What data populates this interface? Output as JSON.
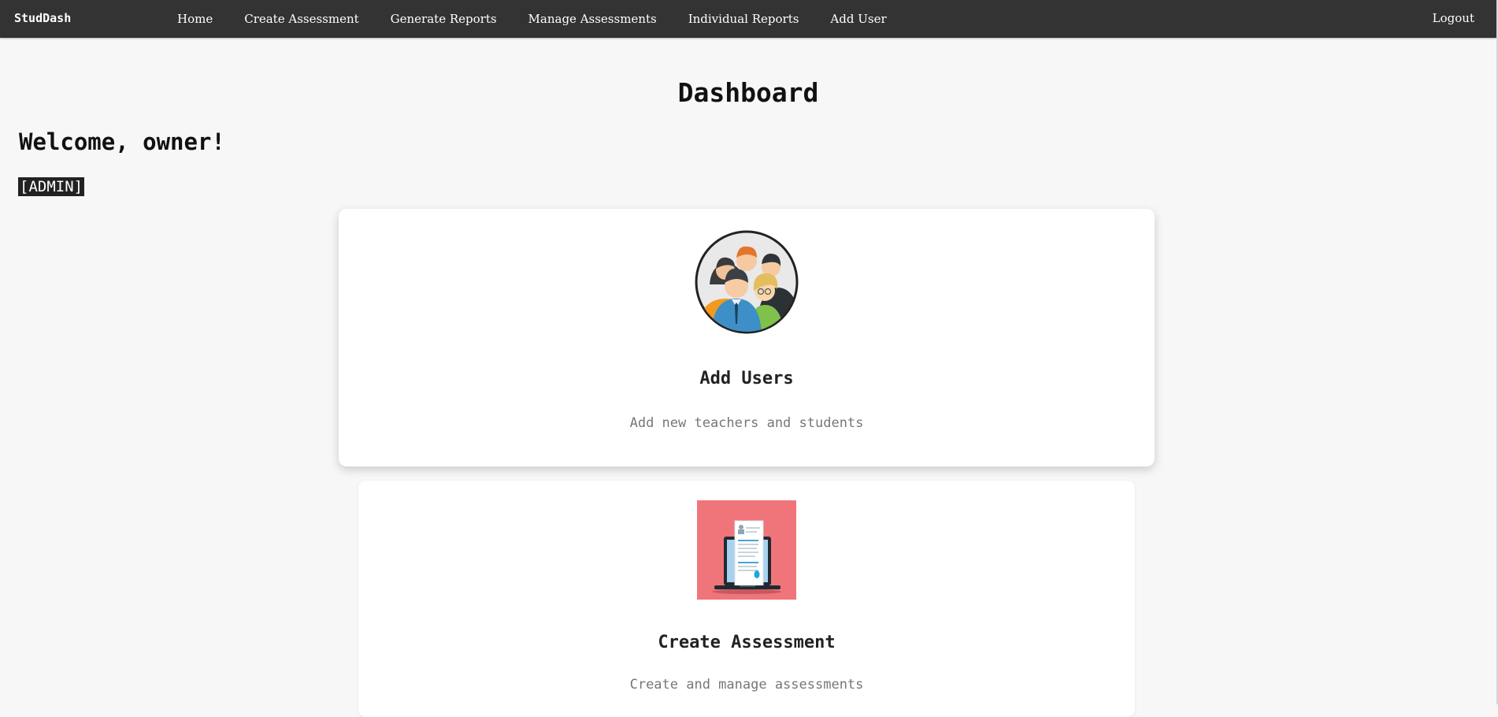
{
  "nav": {
    "brand": "StudDash",
    "links": [
      {
        "label": "Home"
      },
      {
        "label": "Create Assessment"
      },
      {
        "label": "Generate Reports"
      },
      {
        "label": "Manage Assessments"
      },
      {
        "label": "Individual Reports"
      },
      {
        "label": "Add User"
      }
    ],
    "logout": "Logout"
  },
  "main": {
    "title": "Dashboard",
    "welcome": "Welcome, owner!",
    "role": "[ADMIN]"
  },
  "cards": [
    {
      "title": "Add Users",
      "description": "Add new teachers and students",
      "icon": "users-group-icon"
    },
    {
      "title": "Create Assessment",
      "description": "Create and manage assessments",
      "icon": "laptop-document-icon"
    }
  ],
  "colors": {
    "navbar_bg": "#333333",
    "page_bg": "#f7f7f7",
    "card_bg": "#ffffff",
    "assessment_icon_bg": "#f0757a"
  }
}
